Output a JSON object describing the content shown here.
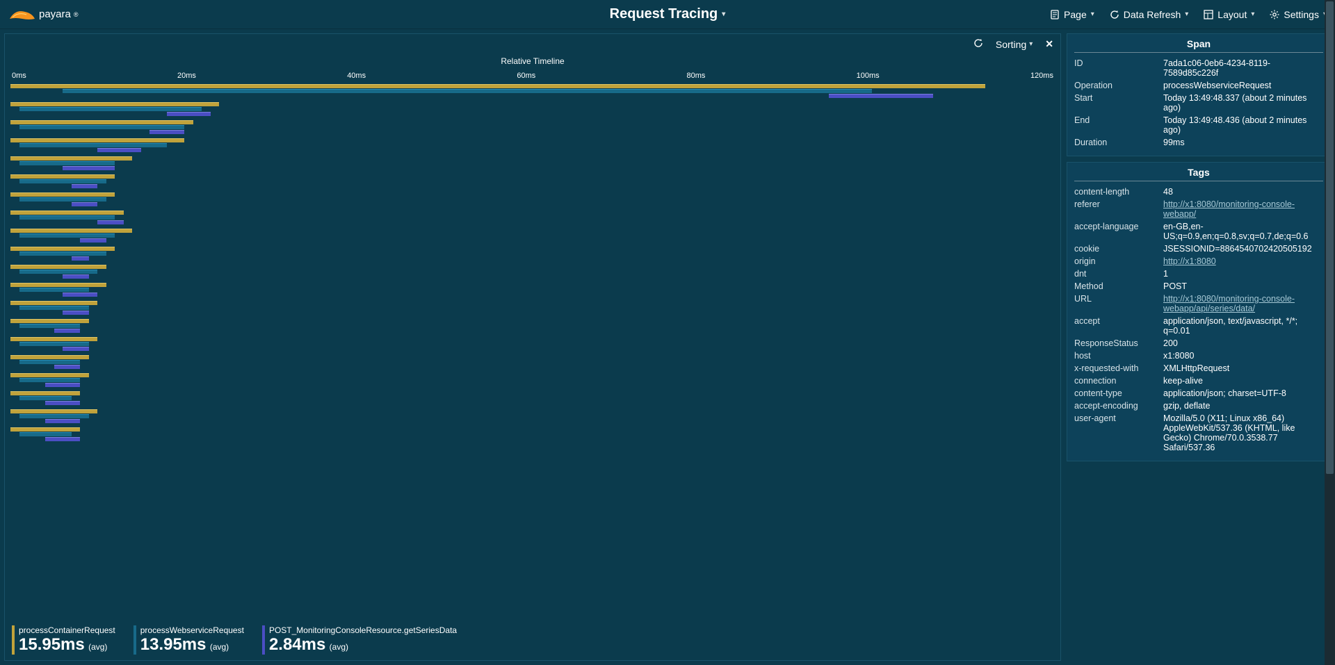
{
  "header": {
    "logo_text": "payara",
    "page_title": "Request Tracing",
    "menus": {
      "page": "Page",
      "data_refresh": "Data Refresh",
      "layout": "Layout",
      "settings": "Settings"
    }
  },
  "panel": {
    "timeline_title": "Relative Timeline",
    "sorting_label": "Sorting",
    "axis_labels": [
      "0ms",
      "20ms",
      "40ms",
      "60ms",
      "80ms",
      "100ms",
      "120ms"
    ],
    "axis_max_ms": 120,
    "series": [
      {
        "name": "processContainerRequest",
        "color": "#c0a23b",
        "avg_label": "15.95ms",
        "avg_suffix": "(avg)"
      },
      {
        "name": "processWebserviceRequest",
        "color": "#176a89",
        "avg_label": "13.95ms",
        "avg_suffix": "(avg)"
      },
      {
        "name": "POST_MonitoringConsoleResource.getSeriesData",
        "color": "#4b4ec4",
        "avg_label": "2.84ms",
        "avg_suffix": "(avg)"
      }
    ],
    "traces": [
      {
        "bars": [
          {
            "s": 0,
            "e": 112,
            "c": 0
          },
          {
            "s": 6,
            "e": 99,
            "c": 1
          },
          {
            "s": 94,
            "e": 106,
            "c": 2
          }
        ]
      },
      {
        "bars": [
          {
            "s": 0,
            "e": 24,
            "c": 0
          },
          {
            "s": 1,
            "e": 22,
            "c": 1
          },
          {
            "s": 18,
            "e": 23,
            "c": 2
          }
        ]
      },
      {
        "bars": [
          {
            "s": 0,
            "e": 21,
            "c": 0
          },
          {
            "s": 1,
            "e": 20,
            "c": 1
          },
          {
            "s": 16,
            "e": 20,
            "c": 2
          }
        ]
      },
      {
        "bars": [
          {
            "s": 0,
            "e": 20,
            "c": 0
          },
          {
            "s": 1,
            "e": 18,
            "c": 1
          },
          {
            "s": 10,
            "e": 15,
            "c": 2
          }
        ]
      },
      {
        "bars": [
          {
            "s": 0,
            "e": 14,
            "c": 0
          },
          {
            "s": 1,
            "e": 12,
            "c": 1
          },
          {
            "s": 6,
            "e": 12,
            "c": 2
          }
        ]
      },
      {
        "bars": [
          {
            "s": 0,
            "e": 12,
            "c": 0
          },
          {
            "s": 1,
            "e": 11,
            "c": 1
          },
          {
            "s": 7,
            "e": 10,
            "c": 2
          }
        ]
      },
      {
        "bars": [
          {
            "s": 0,
            "e": 12,
            "c": 0
          },
          {
            "s": 1,
            "e": 11,
            "c": 1
          },
          {
            "s": 7,
            "e": 10,
            "c": 2
          }
        ]
      },
      {
        "bars": [
          {
            "s": 0,
            "e": 13,
            "c": 0
          },
          {
            "s": 1,
            "e": 12,
            "c": 1
          },
          {
            "s": 10,
            "e": 13,
            "c": 2
          }
        ]
      },
      {
        "bars": [
          {
            "s": 0,
            "e": 14,
            "c": 0
          },
          {
            "s": 1,
            "e": 12,
            "c": 1
          },
          {
            "s": 8,
            "e": 11,
            "c": 2
          }
        ]
      },
      {
        "bars": [
          {
            "s": 0,
            "e": 12,
            "c": 0
          },
          {
            "s": 1,
            "e": 11,
            "c": 1
          },
          {
            "s": 7,
            "e": 9,
            "c": 2
          }
        ]
      },
      {
        "bars": [
          {
            "s": 0,
            "e": 11,
            "c": 0
          },
          {
            "s": 1,
            "e": 10,
            "c": 1
          },
          {
            "s": 6,
            "e": 9,
            "c": 2
          }
        ]
      },
      {
        "bars": [
          {
            "s": 0,
            "e": 11,
            "c": 0
          },
          {
            "s": 1,
            "e": 9,
            "c": 1
          },
          {
            "s": 6,
            "e": 10,
            "c": 2
          }
        ]
      },
      {
        "bars": [
          {
            "s": 0,
            "e": 10,
            "c": 0
          },
          {
            "s": 1,
            "e": 9,
            "c": 1
          },
          {
            "s": 6,
            "e": 9,
            "c": 2
          }
        ]
      },
      {
        "bars": [
          {
            "s": 0,
            "e": 9,
            "c": 0
          },
          {
            "s": 1,
            "e": 8,
            "c": 1
          },
          {
            "s": 5,
            "e": 8,
            "c": 2
          }
        ]
      },
      {
        "bars": [
          {
            "s": 0,
            "e": 10,
            "c": 0
          },
          {
            "s": 1,
            "e": 9,
            "c": 1
          },
          {
            "s": 6,
            "e": 9,
            "c": 2
          }
        ]
      },
      {
        "bars": [
          {
            "s": 0,
            "e": 9,
            "c": 0
          },
          {
            "s": 1,
            "e": 8,
            "c": 1
          },
          {
            "s": 5,
            "e": 8,
            "c": 2
          }
        ]
      },
      {
        "bars": [
          {
            "s": 0,
            "e": 9,
            "c": 0
          },
          {
            "s": 1,
            "e": 8,
            "c": 1
          },
          {
            "s": 4,
            "e": 8,
            "c": 2
          }
        ]
      },
      {
        "bars": [
          {
            "s": 0,
            "e": 8,
            "c": 0
          },
          {
            "s": 1,
            "e": 7,
            "c": 1
          },
          {
            "s": 4,
            "e": 8,
            "c": 2
          }
        ]
      },
      {
        "bars": [
          {
            "s": 0,
            "e": 10,
            "c": 0
          },
          {
            "s": 1,
            "e": 9,
            "c": 1
          },
          {
            "s": 4,
            "e": 8,
            "c": 2
          }
        ]
      },
      {
        "bars": [
          {
            "s": 0,
            "e": 8,
            "c": 0
          },
          {
            "s": 1,
            "e": 7,
            "c": 1
          },
          {
            "s": 4,
            "e": 8,
            "c": 2
          }
        ]
      }
    ]
  },
  "span": {
    "title": "Span",
    "rows": [
      {
        "k": "ID",
        "v": "7ada1c06-0eb6-4234-8119-7589d85c226f"
      },
      {
        "k": "Operation",
        "v": "processWebserviceRequest"
      },
      {
        "k": "Start",
        "v": "Today 13:49:48.337 (about 2 minutes ago)"
      },
      {
        "k": "End",
        "v": "Today 13:49:48.436 (about 2 minutes ago)"
      },
      {
        "k": "Duration",
        "v": "99ms"
      }
    ]
  },
  "tags": {
    "title": "Tags",
    "rows": [
      {
        "k": "content-length",
        "v": "48"
      },
      {
        "k": "referer",
        "v": "http://x1:8080/monitoring-console-webapp/",
        "link": true
      },
      {
        "k": "accept-language",
        "v": "en-GB,en-US;q=0.9,en;q=0.8,sv;q=0.7,de;q=0.6"
      },
      {
        "k": "cookie",
        "v": "JSESSIONID=8864540702420505192"
      },
      {
        "k": "origin",
        "v": "http://x1:8080",
        "link": true
      },
      {
        "k": "dnt",
        "v": "1"
      },
      {
        "k": "Method",
        "v": "POST"
      },
      {
        "k": "URL",
        "v": "http://x1:8080/monitoring-console-webapp/api/series/data/",
        "link": true
      },
      {
        "k": "accept",
        "v": "application/json, text/javascript, */*; q=0.01"
      },
      {
        "k": "ResponseStatus",
        "v": "200"
      },
      {
        "k": "host",
        "v": "x1:8080"
      },
      {
        "k": "x-requested-with",
        "v": "XMLHttpRequest"
      },
      {
        "k": "connection",
        "v": "keep-alive"
      },
      {
        "k": "content-type",
        "v": "application/json; charset=UTF-8"
      },
      {
        "k": "accept-encoding",
        "v": "gzip, deflate"
      },
      {
        "k": "user-agent",
        "v": "Mozilla/5.0 (X11; Linux x86_64) AppleWebKit/537.36 (KHTML, like Gecko) Chrome/70.0.3538.77 Safari/537.36"
      }
    ]
  },
  "chart_data": {
    "type": "bar",
    "title": "Relative Timeline",
    "xlabel": "ms",
    "xlim": [
      0,
      120
    ],
    "series": [
      {
        "name": "processContainerRequest",
        "avg_ms": 15.95,
        "color": "#c0a23b"
      },
      {
        "name": "processWebserviceRequest",
        "avg_ms": 13.95,
        "color": "#176a89"
      },
      {
        "name": "POST_MonitoringConsoleResource.getSeriesData",
        "avg_ms": 2.84,
        "color": "#4b4ec4"
      }
    ],
    "traces_comment": "Each trace is a request; each span has start/end in ms and series index c",
    "traces": "see panel.traces"
  }
}
